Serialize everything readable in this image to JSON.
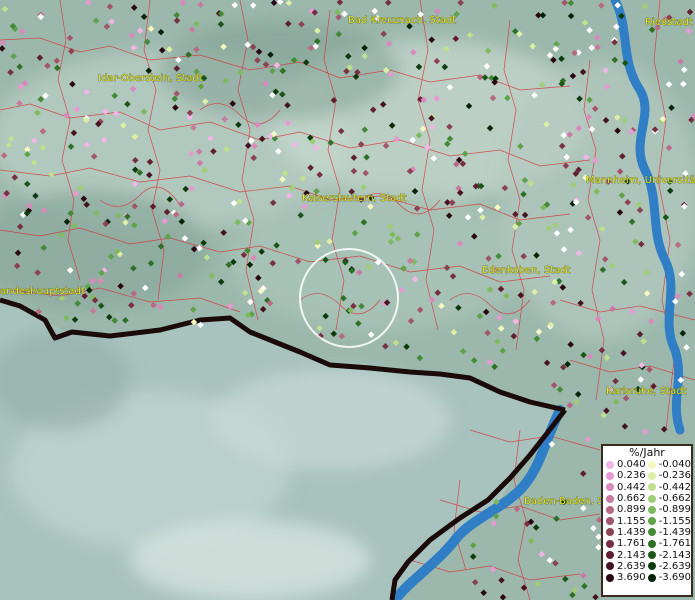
{
  "map": {
    "labels": [
      {
        "id": "bad-kreuznach",
        "text": "Bad Kreuznach, Stadt"
      },
      {
        "id": "riedstadt",
        "text": "Riedstadt"
      },
      {
        "id": "idar-oberstein",
        "text": "Idar-Oberstein, Stadt"
      },
      {
        "id": "mannheim",
        "text": "Mannheim, Universitätsstadt"
      },
      {
        "id": "kaiserslautern",
        "text": "Kaiserslautern, Stadt"
      },
      {
        "id": "edenkoben",
        "text": "Edenkoben, Stadt"
      },
      {
        "id": "landeshauptstadt",
        "text": "andeshauptstadt"
      },
      {
        "id": "karlsruhe",
        "text": "Karlsruhe, Stadt"
      },
      {
        "id": "baden-baden",
        "text": "Baden-Baden, Stadt"
      }
    ]
  },
  "legend": {
    "title": "%/Jahr",
    "positive": [
      {
        "value": "0.040",
        "color": "#f2b6e6"
      },
      {
        "value": "0.236",
        "color": "#e79ad2"
      },
      {
        "value": "0.442",
        "color": "#d989bb"
      },
      {
        "value": "0.662",
        "color": "#c97aa0"
      },
      {
        "value": "0.899",
        "color": "#b86984"
      },
      {
        "value": "1.155",
        "color": "#a3566b"
      },
      {
        "value": "1.439",
        "color": "#8c4255"
      },
      {
        "value": "1.761",
        "color": "#763042"
      },
      {
        "value": "2.143",
        "color": "#5f1f30"
      },
      {
        "value": "2.639",
        "color": "#471222"
      },
      {
        "value": "3.690",
        "color": "#2a0712"
      }
    ],
    "negative": [
      {
        "value": "-0.040",
        "color": "#f5f8bf"
      },
      {
        "value": "-0.236",
        "color": "#dcefa6"
      },
      {
        "value": "-0.442",
        "color": "#bfe08d"
      },
      {
        "value": "-0.662",
        "color": "#9fce75"
      },
      {
        "value": "-0.899",
        "color": "#7fba5e"
      },
      {
        "value": "-1.155",
        "color": "#5ea249"
      },
      {
        "value": "-1.439",
        "color": "#438a36"
      },
      {
        "value": "-1.761",
        "color": "#2d7026"
      },
      {
        "value": "-2.143",
        "color": "#1a5618"
      },
      {
        "value": "-2.639",
        "color": "#0c3c0d"
      },
      {
        "value": "-3.690",
        "color": "#042205"
      }
    ]
  }
}
